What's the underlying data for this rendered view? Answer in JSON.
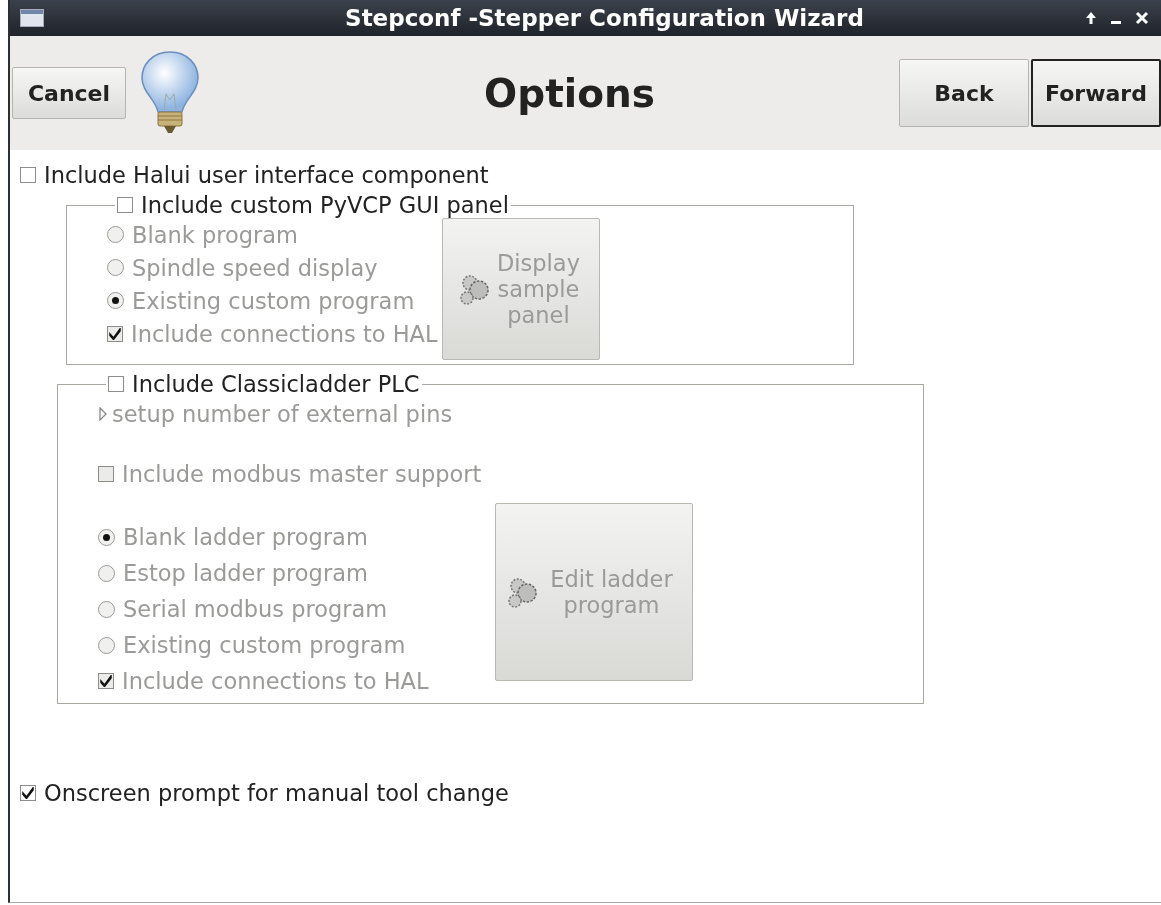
{
  "window": {
    "title": "Stepconf -Stepper Configuration Wizard"
  },
  "header": {
    "cancel": {
      "label": "Cancel"
    },
    "title": "Options",
    "nav": [
      {
        "label": "Back",
        "focused": false
      },
      {
        "label": "Forward",
        "focused": true
      }
    ]
  },
  "options": [
    {
      "kind": "checkbox",
      "label": "Include Halui user interface component",
      "checked": false,
      "disabled": false
    },
    {
      "kind": "frame",
      "label": "Include custom PyVCP GUI panel",
      "checked": false,
      "items": [
        {
          "kind": "radio",
          "label": "Blank program",
          "selected": false,
          "disabled": true
        },
        {
          "kind": "radio",
          "label": "Spindle speed display",
          "selected": false,
          "disabled": true
        },
        {
          "kind": "radio",
          "label": "Existing custom program",
          "selected": true,
          "disabled": true
        },
        {
          "kind": "checkbox",
          "label": "Include connections to HAL",
          "checked": true,
          "disabled": true
        }
      ],
      "button": {
        "label": "Display sample panel",
        "disabled": true
      }
    },
    {
      "kind": "frame",
      "label": "Include Classicladder PLC",
      "checked": false,
      "top_items": [
        {
          "kind": "expander",
          "label": "setup number of external pins",
          "expanded": false,
          "disabled": true
        },
        {
          "kind": "checkbox",
          "label": "Include modbus master support",
          "checked": false,
          "disabled": true
        }
      ],
      "items": [
        {
          "kind": "radio",
          "label": "Blank ladder program",
          "selected": true,
          "disabled": true
        },
        {
          "kind": "radio",
          "label": "Estop ladder program",
          "selected": false,
          "disabled": true
        },
        {
          "kind": "radio",
          "label": "Serial modbus program",
          "selected": false,
          "disabled": true
        },
        {
          "kind": "radio",
          "label": "Existing custom program",
          "selected": false,
          "disabled": true
        },
        {
          "kind": "checkbox",
          "label": "Include connections to HAL",
          "checked": true,
          "disabled": true
        }
      ],
      "button": {
        "label": "Edit ladder program",
        "disabled": true
      }
    },
    {
      "kind": "checkbox",
      "label": "Onscreen prompt for manual tool change",
      "checked": true,
      "disabled": false
    }
  ]
}
